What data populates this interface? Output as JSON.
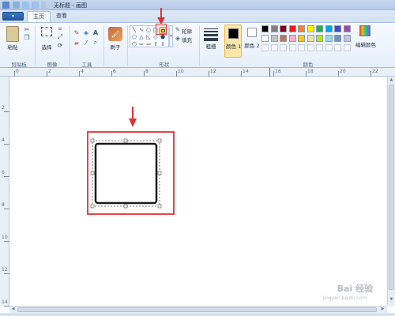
{
  "app": {
    "title": "无标题 - 画图"
  },
  "tabs": {
    "menu_label": "▾",
    "home": "主页",
    "view": "查看"
  },
  "ribbon": {
    "clipboard": {
      "paste": "粘贴",
      "group": "剪贴板"
    },
    "image": {
      "select": "选择",
      "group": "图像"
    },
    "tools": {
      "group": "工具"
    },
    "brushes": {
      "label": "刷子"
    },
    "shapes": {
      "group": "形状",
      "outline": "轮廓",
      "fill": "填充",
      "icons": [
        "line-icon",
        "curve-icon",
        "oval-icon",
        "rectangle-icon",
        "rounded-rectangle-icon",
        "polygon-icon",
        "triangle-icon",
        "right-triangle-icon",
        "diamond-icon",
        "pentagon-icon",
        "hexagon-icon",
        "arrow-right-icon",
        "arrow-left-icon",
        "arrow-up-icon",
        "arrow-down-icon"
      ]
    },
    "size": {
      "label": "粗细"
    },
    "colors": {
      "color1": "颜色 1",
      "color2": "颜色 2",
      "group": "颜色",
      "edit": "编辑颜色",
      "palette_row1": [
        "#000000",
        "#7f7f7f",
        "#880015",
        "#ed1c24",
        "#ff7f27",
        "#fff200",
        "#22b14c",
        "#00a2e8",
        "#3f48cc",
        "#a349a4"
      ],
      "palette_row2": [
        "#ffffff",
        "#c3c3c3",
        "#b97a57",
        "#ffaec9",
        "#ffc90e",
        "#efe4b0",
        "#b5e61d",
        "#99d9ea",
        "#7092be",
        "#c8bfe7"
      ],
      "color1_value": "#000000",
      "color2_value": "#ffffff"
    }
  },
  "ruler": {
    "h_ticks": [
      "0",
      "2",
      "4",
      "6",
      "8",
      "10",
      "12",
      "14",
      "16",
      "18",
      "20",
      "22"
    ],
    "v_ticks": [
      "2",
      "4",
      "6",
      "8",
      "10",
      "12",
      "14"
    ]
  },
  "annotation": {
    "highlight_color": "#e03131"
  },
  "watermark": {
    "text": "Bai 经验",
    "url": "jingyan.baidu.com"
  }
}
